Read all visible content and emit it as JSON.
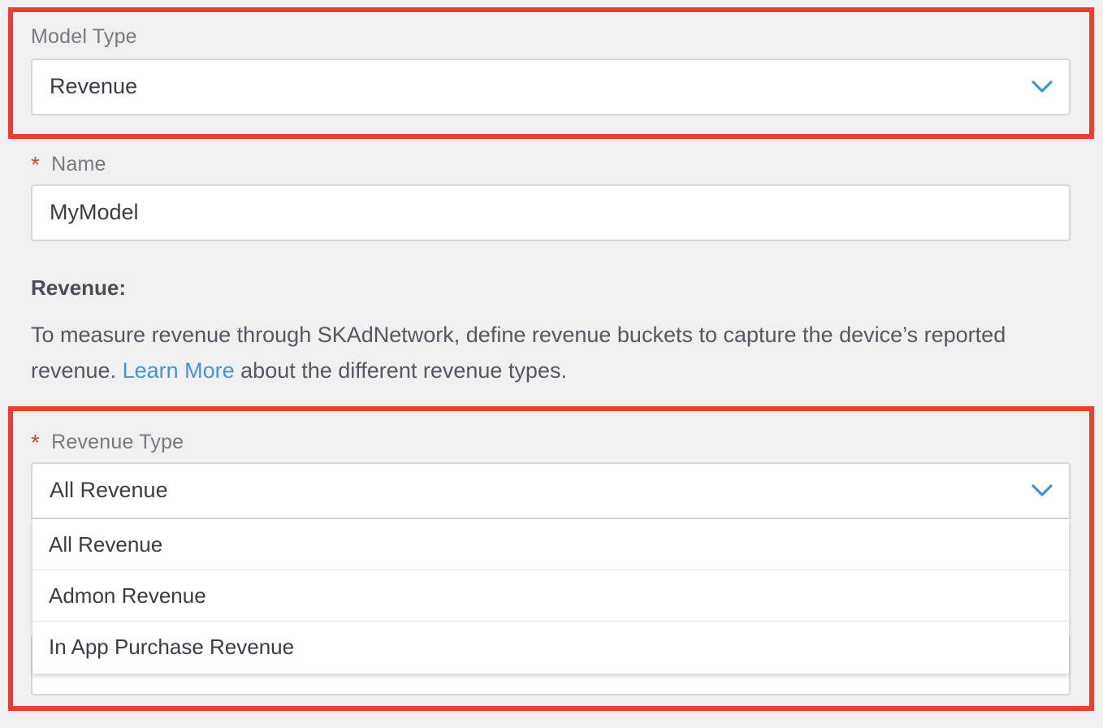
{
  "model_type": {
    "label": "Model Type",
    "value": "Revenue",
    "icon": "chevron-down-icon"
  },
  "name": {
    "required_mark": "*",
    "label": "Name",
    "value": "MyModel"
  },
  "revenue_section": {
    "title": "Revenue:",
    "desc_before": "To measure revenue through SKAdNetwork, define revenue buckets to capture the device’s reported revenue. ",
    "learn_more": "Learn More",
    "desc_after": " about the different revenue types."
  },
  "revenue_type": {
    "required_mark": "*",
    "label": "Revenue Type",
    "value": "All Revenue",
    "icon": "chevron-down-icon",
    "options": [
      "All Revenue",
      "Admon Revenue",
      "In App Purchase Revenue"
    ]
  },
  "colors": {
    "highlight": "#e8402a",
    "accent": "#4a90d9",
    "required": "#d0453a",
    "background": "#f0f0f0"
  }
}
